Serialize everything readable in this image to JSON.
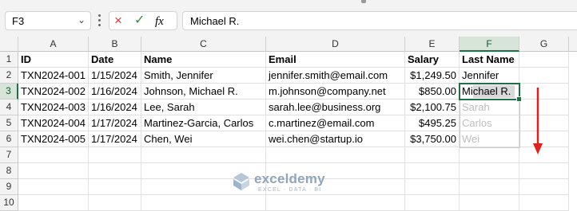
{
  "formula_bar": {
    "name_box": "F3",
    "cancel_icon": "×",
    "enter_icon": "✓",
    "fx_label": "fx",
    "formula_value": "Michael R."
  },
  "columns": [
    "A",
    "B",
    "C",
    "D",
    "E",
    "F",
    "G"
  ],
  "rows": [
    "1",
    "2",
    "3",
    "4",
    "5",
    "6",
    "7",
    "8",
    "9",
    "10"
  ],
  "headers": {
    "id": "ID",
    "date": "Date",
    "name": "Name",
    "email": "Email",
    "salary": "Salary",
    "last_name": "Last Name"
  },
  "data_rows": [
    {
      "id": "TXN2024-001",
      "date": "1/15/2024",
      "name": "Smith, Jennifer",
      "email": "jennifer.smith@email.com",
      "salary": "$1,249.50",
      "last_name": "Jennifer"
    },
    {
      "id": "TXN2024-002",
      "date": "1/16/2024",
      "name": "Johnson, Michael R.",
      "email": "m.johnson@company.net",
      "salary": "$850.00",
      "last_name": "Michael R."
    },
    {
      "id": "TXN2024-003",
      "date": "1/16/2024",
      "name": "Lee, Sarah",
      "email": "sarah.lee@business.org",
      "salary": "$2,100.75",
      "last_name": "Sarah"
    },
    {
      "id": "TXN2024-004",
      "date": "1/17/2024",
      "name": "Martinez-Garcia, Carlos",
      "email": "c.martinez@email.com",
      "salary": "$495.25",
      "last_name": "Carlos"
    },
    {
      "id": "TXN2024-005",
      "date": "1/17/2024",
      "name": "Chen, Wei",
      "email": "wei.chen@startup.io",
      "salary": "$3,750.00",
      "last_name": "Wei"
    }
  ],
  "active_cell": "F3",
  "flash_fill_preview": [
    "Sarah",
    "Carlos",
    "Wei"
  ],
  "watermark": {
    "name": "exceldemy",
    "tagline": "EXCEL · DATA · BI"
  },
  "colors": {
    "accent": "#1e7145",
    "arrow": "#e0201b",
    "ghost_text": "#bdbdbd"
  }
}
